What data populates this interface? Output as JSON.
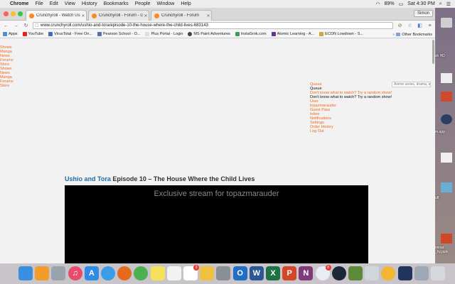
{
  "menubar": {
    "apple": "",
    "items": [
      "Chrome",
      "File",
      "Edit",
      "View",
      "History",
      "Bookmarks",
      "People",
      "Window",
      "Help"
    ],
    "battery": "89%",
    "clock": "Sat 4:30 PM"
  },
  "tabs": [
    {
      "title": "Crunchyroll - Watch Ushio...",
      "active": true
    },
    {
      "title": "Crunchyroll - Forum - Gon...",
      "active": false
    },
    {
      "title": "Crunchyroll - Forum",
      "active": false
    }
  ],
  "user_badge": "Simon",
  "address": "www.crunchyroll.com/ushio-and-tora/episode-10-the-house-where-the-child-lives-683143",
  "bookmarks": [
    {
      "label": "Apps",
      "color": "#4a90d9"
    },
    {
      "label": "YouTube",
      "color": "#e62117"
    },
    {
      "label": "VirusTotal - Free On...",
      "color": "#3a6fb7"
    },
    {
      "label": "Pearson School - O...",
      "color": "#5b6db3"
    },
    {
      "label": "Plus Portal - Login",
      "color": "#dddddd"
    },
    {
      "label": "MS Paint Adventures",
      "color": "#444444"
    },
    {
      "label": "InstaGrok.com",
      "color": "#3d9a5b"
    },
    {
      "label": "Atomic Learning - A...",
      "color": "#663399"
    },
    {
      "label": "ECON Lowdown - S...",
      "color": "#caa93a"
    }
  ],
  "bookmarks_other": "Other Bookmarks",
  "page": {
    "left_nav": [
      {
        "text": "Shows",
        "link": true
      },
      {
        "text": "Manga",
        "link": true
      },
      {
        "text": "News",
        "link": true
      },
      {
        "text": "Forums",
        "link": true
      },
      {
        "text": "Store",
        "link": true
      },
      {
        "text": "Shows",
        "link": true
      },
      {
        "text": "News",
        "link": true
      },
      {
        "text": "Manga",
        "link": true
      },
      {
        "text": "Forums",
        "link": true
      },
      {
        "text": "Store",
        "link": true
      }
    ],
    "search_placeholder": "Anime series, drama, et",
    "user_nav": [
      {
        "text": "Queue",
        "link": true
      },
      {
        "text": "Queue",
        "link": false
      },
      {
        "text": "Don't know what to watch? Try a random show!",
        "link": true
      },
      {
        "text": "Don't know what to watch? Try a random show!",
        "link": false
      },
      {
        "text": "User",
        "link": true
      },
      {
        "text": "topazmarauder",
        "link": true
      },
      {
        "text": "Guest Pass",
        "link": true
      },
      {
        "text": "Inbox",
        "link": true
      },
      {
        "text": "Notifications",
        "link": true
      },
      {
        "text": "Settings",
        "link": true
      },
      {
        "text": "Order History",
        "link": true
      },
      {
        "text": "Log Out",
        "link": true
      }
    ],
    "show_title": "Ushio and Tora",
    "episode_title": "Episode 10 – The House Where the Child Lives",
    "player_message": "Exclusive stream for topazmarauder"
  },
  "desktop": [
    {
      "label": "sh HD",
      "icon": "drive-icon",
      "color": "#cfcfcf"
    },
    {
      "label": "",
      "icon": "file-icon",
      "color": "#eeeeee"
    },
    {
      "label": "",
      "icon": "chart-file-icon",
      "color": "#d04a2f"
    },
    {
      "label": "m.app",
      "icon": "app-icon",
      "color": "#2c3e63"
    },
    {
      "label": "",
      "icon": "text-file-icon",
      "color": "#f0f0f0"
    },
    {
      "label": "uff",
      "icon": "folder-icon",
      "color": "#6aaed6"
    },
    {
      "label": "minar\n_hy.pptx",
      "icon": "pptx-icon",
      "color": "#d24726"
    }
  ],
  "dock": [
    {
      "name": "finder-icon",
      "color": "#3b8fe0",
      "glyph": ""
    },
    {
      "name": "ibooks-icon",
      "color": "#f39c2a",
      "glyph": ""
    },
    {
      "name": "launchpad-icon",
      "color": "#9aa4ad",
      "glyph": ""
    },
    {
      "name": "itunes-icon",
      "color": "#e84c6a",
      "glyph": "♫"
    },
    {
      "name": "app-store-icon",
      "color": "#2f8be6",
      "glyph": "A"
    },
    {
      "name": "safari-icon",
      "color": "#3a9de8",
      "glyph": ""
    },
    {
      "name": "firefox-icon",
      "color": "#e66a1e",
      "glyph": ""
    },
    {
      "name": "chrome-icon",
      "color": "#4caf50",
      "glyph": ""
    },
    {
      "name": "notes-icon",
      "color": "#f5e15a",
      "glyph": ""
    },
    {
      "name": "reminders-icon",
      "color": "#f2f2f2",
      "glyph": ""
    },
    {
      "name": "calendar-icon",
      "color": "#ffffff",
      "glyph": ""
    },
    {
      "name": "photos-icon",
      "color": "#f0c040",
      "glyph": ""
    },
    {
      "name": "system-preferences-icon",
      "color": "#8a8f96",
      "glyph": ""
    },
    {
      "name": "outlook-icon",
      "color": "#1f6fc5",
      "glyph": "O"
    },
    {
      "name": "word-icon",
      "color": "#2b5797",
      "glyph": "W"
    },
    {
      "name": "excel-icon",
      "color": "#1e7145",
      "glyph": "X"
    },
    {
      "name": "powerpoint-icon",
      "color": "#d24726",
      "glyph": "P"
    },
    {
      "name": "onenote-icon",
      "color": "#80397b",
      "glyph": "N"
    },
    {
      "name": "itunes-alt-icon",
      "color": "#e8ecf3",
      "glyph": ""
    },
    {
      "name": "steam-icon",
      "color": "#1b2838",
      "glyph": ""
    },
    {
      "name": "minecraft-icon",
      "color": "#5d8a3a",
      "glyph": ""
    },
    {
      "name": "preview-icon",
      "color": "#cfd6dc",
      "glyph": ""
    },
    {
      "name": "chrome-canary-icon",
      "color": "#f2b632",
      "glyph": ""
    },
    {
      "name": "eclipse-icon",
      "color": "#21355c",
      "glyph": ""
    },
    {
      "name": "downloads-icon",
      "color": "#9ea7b3",
      "glyph": ""
    },
    {
      "name": "trash-icon",
      "color": "#d5d9dd",
      "glyph": ""
    }
  ],
  "dock_badges": {
    "calendar": "3",
    "itunes_alt": "8"
  }
}
